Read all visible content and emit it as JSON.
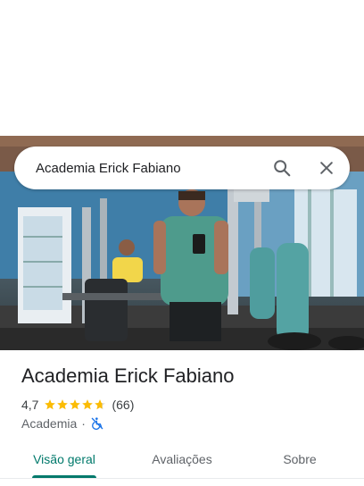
{
  "search": {
    "query": "Academia Erick Fabiano"
  },
  "place": {
    "name": "Academia Erick Fabiano",
    "rating": "4,7",
    "rating_value": 4.7,
    "review_count": "(66)",
    "category": "Academia",
    "separator": "·",
    "accessibility_icon": "wheelchair-crossed-icon"
  },
  "tabs": [
    {
      "label": "Visão geral",
      "active": true
    },
    {
      "label": "Avaliações",
      "active": false
    },
    {
      "label": "Sobre",
      "active": false
    }
  ],
  "colors": {
    "accent": "#00796b",
    "star": "#fbbc04",
    "accessibility_icon": "#1a73e8"
  }
}
